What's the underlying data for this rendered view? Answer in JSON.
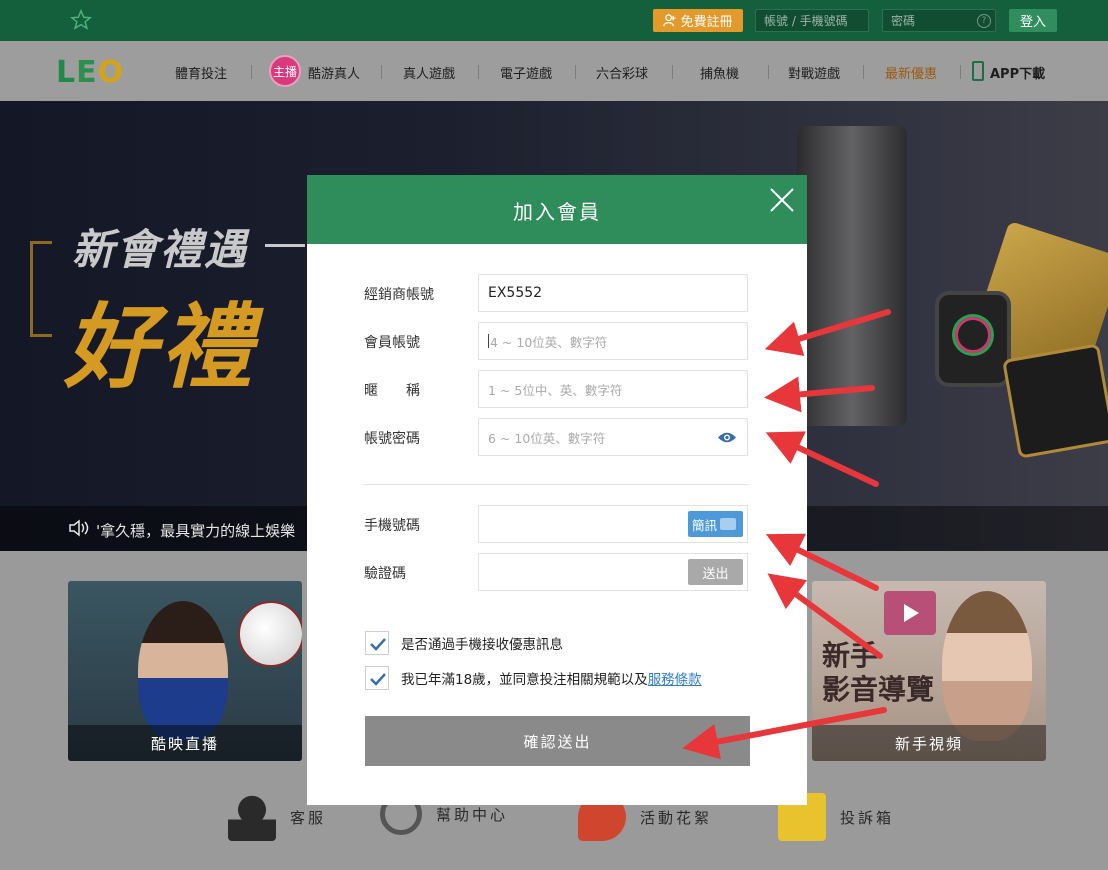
{
  "topbar": {
    "register_label": "免費註冊",
    "account_placeholder": "帳號 / 手機號碼",
    "password_placeholder": "密碼",
    "help_glyph": "?",
    "login_label": "登入"
  },
  "nav": {
    "logo": {
      "l": "L",
      "e": "E",
      "o": "O"
    },
    "badge": "主播",
    "items": [
      "體育投注",
      "酷游真人",
      "真人遊戲",
      "電子遊戲",
      "六合彩球",
      "捕魚機",
      "對戰遊戲",
      "最新優惠",
      "APP下載"
    ]
  },
  "hero": {
    "title1": "新會禮遇",
    "title2": "好禮",
    "marquee": "'拿久穩，最具實力的線上娛樂"
  },
  "cards": {
    "live_label": "酷映直播",
    "video_label": "新手視頻",
    "video_overlay_line1": "新手",
    "video_overlay_line2": "影音導覽"
  },
  "bottom_links": [
    "客服",
    "幫助中心",
    "活動花絮",
    "投訴箱"
  ],
  "modal": {
    "title": "加入會員",
    "fields": {
      "agent": {
        "label": "經銷商帳號",
        "value": "EX5552"
      },
      "member": {
        "label": "會員帳號",
        "placeholder": "4 ~ 10位英、數字符"
      },
      "nickname": {
        "label": "暱　　稱",
        "placeholder": "1 ~ 5位中、英、數字符"
      },
      "password": {
        "label": "帳號密碼",
        "placeholder": "6 ~ 10位英、數字符"
      },
      "phone": {
        "label": "手機號碼",
        "sms_button": "簡訊"
      },
      "code": {
        "label": "驗證碼",
        "send_button": "送出"
      }
    },
    "checkbox_promo": "是否通過手機接收優惠訊息",
    "checkbox_terms": "我已年滿18歲，並同意投注相關規範以及",
    "terms_link": "服務條款",
    "submit": "確認送出"
  },
  "colors": {
    "topbar_bg": "#14603c",
    "modal_header": "#2e8d5a",
    "register_btn": "#e39a2a",
    "sms_btn": "#4e9ad8",
    "annotation_arrow": "#e8373a"
  }
}
